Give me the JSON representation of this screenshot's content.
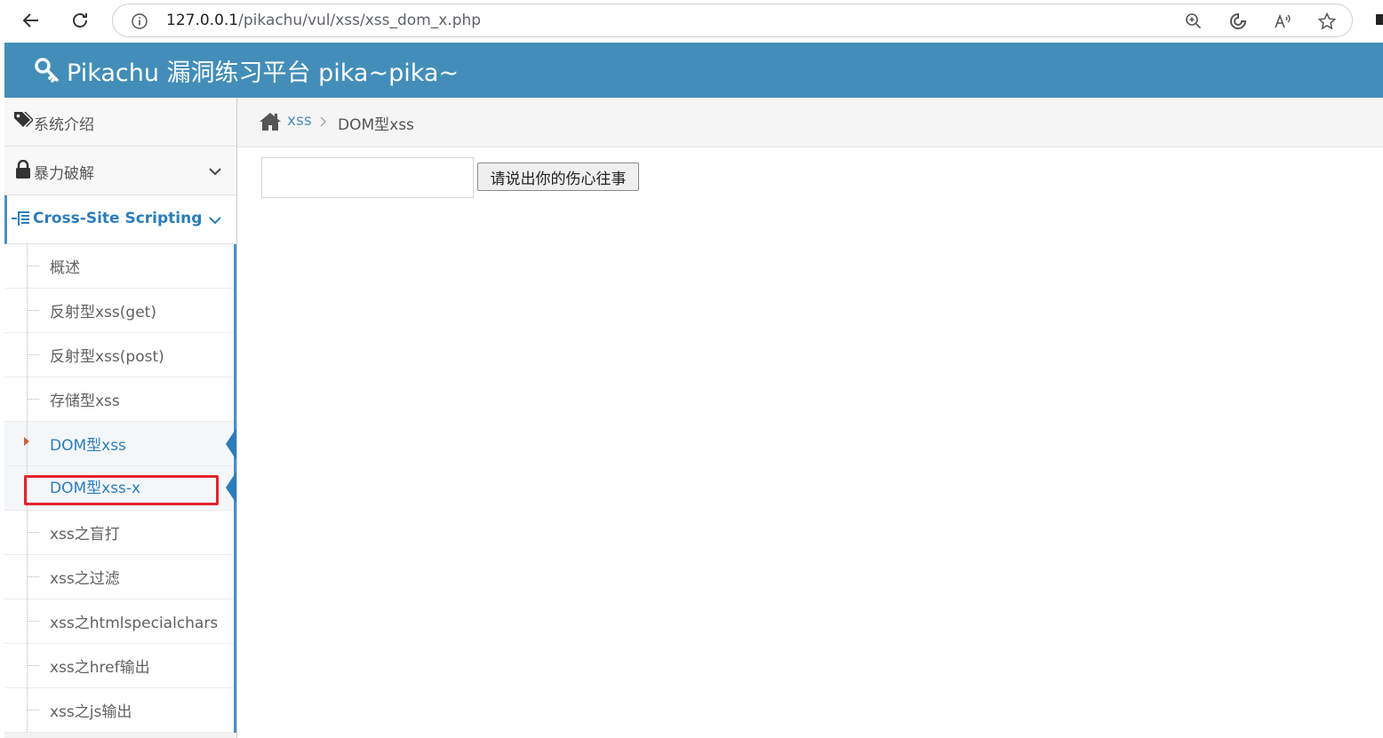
{
  "browser": {
    "url_host": "127.0.0.1",
    "url_path": "/pikachu/vul/xss/xss_dom_x.php",
    "icons": [
      "back-icon",
      "refresh-icon",
      "info-icon",
      "zoom-icon",
      "edge-copilot-icon",
      "read-aloud-icon",
      "favorite-star-icon"
    ]
  },
  "header": {
    "title": "Pikachu 漏洞练习平台 pika~pika~",
    "bg_color": "#438eb9"
  },
  "sidebar": {
    "items": [
      {
        "label": "系统介绍",
        "icon": "tags-icon"
      },
      {
        "label": "暴力破解",
        "icon": "lock-icon"
      },
      {
        "label": "Cross-Site Scripting",
        "icon": "list-tree-icon"
      }
    ],
    "submenu": [
      {
        "label": "概述"
      },
      {
        "label": "反射型xss(get)"
      },
      {
        "label": "反射型xss(post)"
      },
      {
        "label": "存储型xss"
      },
      {
        "label": "DOM型xss"
      },
      {
        "label": "DOM型xss-x"
      },
      {
        "label": "xss之盲打"
      },
      {
        "label": "xss之过滤"
      },
      {
        "label": "xss之htmlspecialchars"
      },
      {
        "label": "xss之href输出"
      },
      {
        "label": "xss之js输出"
      }
    ],
    "accent_color": "#2b7dbc",
    "highlight_color": "#e5232a"
  },
  "breadcrumb": {
    "link": "xss",
    "current": "DOM型xss"
  },
  "form": {
    "input_value": "",
    "button_label": "请说出你的伤心往事"
  }
}
